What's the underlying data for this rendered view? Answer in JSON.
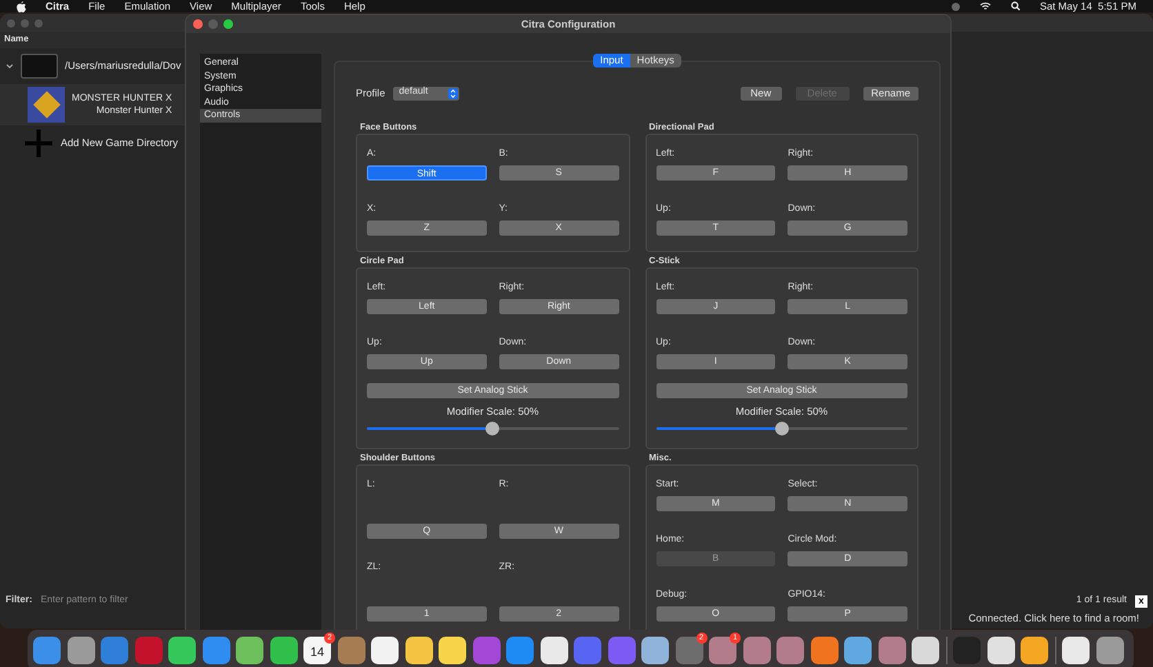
{
  "menu_bar": {
    "items": [
      {
        "label": "Citra",
        "bold": true
      },
      {
        "label": "File",
        "bold": false
      },
      {
        "label": "Emulation",
        "bold": false
      },
      {
        "label": "View",
        "bold": false
      },
      {
        "label": "Multiplayer",
        "bold": false
      },
      {
        "label": "Tools",
        "bold": false
      },
      {
        "label": "Help",
        "bold": false
      }
    ],
    "clock": "Sat May 14  5:51 PM"
  },
  "game_list": {
    "header": "Name",
    "rows": [
      {
        "kind": "folder",
        "title": "/Users/mariusredulla/Dov",
        "expanded": true
      },
      {
        "kind": "game",
        "title": "MONSTER HUNTER X",
        "subtitle": "Monster Hunter X"
      },
      {
        "kind": "add",
        "title": "Add New Game Directory"
      }
    ],
    "filter": {
      "label": "Filter:",
      "placeholder": "Enter pattern to filter"
    },
    "result": "1 of 1 result",
    "clear": "x",
    "status": "Connected. Click here to find a room!"
  },
  "config": {
    "title": "Citra Configuration",
    "sidebar": [
      {
        "label": "General",
        "selected": false
      },
      {
        "label": "System",
        "selected": false
      },
      {
        "label": "Graphics",
        "selected": false
      },
      {
        "label": "Audio",
        "selected": false
      },
      {
        "label": "Controls",
        "selected": true
      }
    ],
    "tabs": [
      {
        "label": "Input",
        "selected": true
      },
      {
        "label": "Hotkeys",
        "selected": false
      }
    ],
    "profile": {
      "label": "Profile",
      "value": "default"
    },
    "profile_buttons": [
      {
        "label": "New",
        "disabled": false
      },
      {
        "label": "Delete",
        "disabled": true
      },
      {
        "label": "Rename",
        "disabled": false
      }
    ],
    "groups": [
      {
        "title": "Face Buttons",
        "bindings": [
          {
            "label": "A:",
            "value": "Shift",
            "selected": true,
            "disabled": false
          },
          {
            "label": "B:",
            "value": "S",
            "selected": false,
            "disabled": false
          },
          {
            "label": "X:",
            "value": "Z",
            "selected": false,
            "disabled": false
          },
          {
            "label": "Y:",
            "value": "X",
            "selected": false,
            "disabled": false
          }
        ]
      },
      {
        "title": "Directional Pad",
        "bindings": [
          {
            "label": "Left:",
            "value": "F",
            "selected": false,
            "disabled": false
          },
          {
            "label": "Right:",
            "value": "H",
            "selected": false,
            "disabled": false
          },
          {
            "label": "Up:",
            "value": "T",
            "selected": false,
            "disabled": false
          },
          {
            "label": "Down:",
            "value": "G",
            "selected": false,
            "disabled": false
          }
        ]
      },
      {
        "title": "Circle Pad",
        "bindings": [
          {
            "label": "Left:",
            "value": "Left",
            "selected": false,
            "disabled": false
          },
          {
            "label": "Right:",
            "value": "Right",
            "selected": false,
            "disabled": false
          },
          {
            "label": "Up:",
            "value": "Up",
            "selected": false,
            "disabled": false
          },
          {
            "label": "Down:",
            "value": "Down",
            "selected": false,
            "disabled": false
          }
        ],
        "stick": {
          "button": "Set Analog Stick",
          "modifier": "Modifier Scale: 50%",
          "level": 0.5
        }
      },
      {
        "title": "C-Stick",
        "bindings": [
          {
            "label": "Left:",
            "value": "J",
            "selected": false,
            "disabled": false
          },
          {
            "label": "Right:",
            "value": "L",
            "selected": false,
            "disabled": false
          },
          {
            "label": "Up:",
            "value": "I",
            "selected": false,
            "disabled": false
          },
          {
            "label": "Down:",
            "value": "K",
            "selected": false,
            "disabled": false
          }
        ],
        "stick": {
          "button": "Set Analog Stick",
          "modifier": "Modifier Scale: 50%",
          "level": 0.5
        }
      },
      {
        "title": "Shoulder Buttons",
        "bindings": [
          {
            "label": "L:",
            "value": "Q",
            "selected": false,
            "disabled": false
          },
          {
            "label": "R:",
            "value": "W",
            "selected": false,
            "disabled": false
          },
          {
            "label": "ZL:",
            "value": "1",
            "selected": false,
            "disabled": false
          },
          {
            "label": "ZR:",
            "value": "2",
            "selected": false,
            "disabled": false
          }
        ]
      },
      {
        "title": "Misc.",
        "bindings": [
          {
            "label": "Start:",
            "value": "M",
            "selected": false,
            "disabled": false
          },
          {
            "label": "Select:",
            "value": "N",
            "selected": false,
            "disabled": false
          },
          {
            "label": "Home:",
            "value": "B",
            "selected": false,
            "disabled": true
          },
          {
            "label": "Circle Mod:",
            "value": "D",
            "selected": false,
            "disabled": false
          },
          {
            "label": "Debug:",
            "value": "O",
            "selected": false,
            "disabled": false
          },
          {
            "label": "GPIO14:",
            "value": "P",
            "selected": false,
            "disabled": false
          }
        ]
      }
    ]
  },
  "dock": [
    {
      "kind": "finder"
    },
    {
      "kind": "launchpad"
    },
    {
      "kind": "safari"
    },
    {
      "kind": "opera"
    },
    {
      "kind": "messages"
    },
    {
      "kind": "mail"
    },
    {
      "kind": "maps"
    },
    {
      "kind": "facetime"
    },
    {
      "kind": "calendar",
      "text": "14",
      "badge": "2"
    },
    {
      "kind": "contacts"
    },
    {
      "kind": "reminders"
    },
    {
      "kind": "pages"
    },
    {
      "kind": "notes"
    },
    {
      "kind": "podcasts"
    },
    {
      "kind": "appstore"
    },
    {
      "kind": "photos"
    },
    {
      "kind": "discord"
    },
    {
      "kind": "messenger"
    },
    {
      "kind": "preview"
    },
    {
      "kind": "settings",
      "badge": "2"
    },
    {
      "kind": "game",
      "badge": "1"
    },
    {
      "kind": "game"
    },
    {
      "kind": "game"
    },
    {
      "kind": "recorder"
    },
    {
      "kind": "ppsspp"
    },
    {
      "kind": "game"
    },
    {
      "kind": "roblox"
    },
    {
      "kind": "separator"
    },
    {
      "kind": "terminal"
    },
    {
      "kind": "configurator"
    },
    {
      "kind": "citra"
    },
    {
      "kind": "separator"
    },
    {
      "kind": "file"
    },
    {
      "kind": "trash"
    }
  ]
}
